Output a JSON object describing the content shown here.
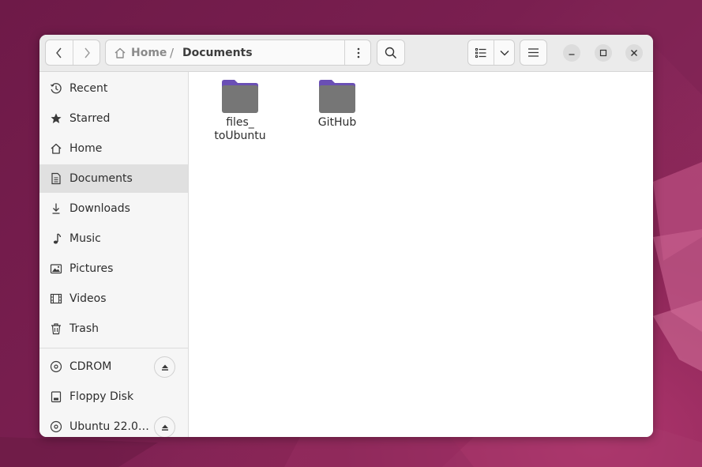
{
  "colors": {
    "wallpaper": "#7a1f50",
    "folder_tab": "#6a4fb5",
    "folder_body": "#767676",
    "sidebar_bg": "#f6f6f6",
    "active_row": "#e0e0e0",
    "headerbar_bg": "#ebebeb"
  },
  "window": {
    "title": "Documents"
  },
  "toolbar": {
    "back_icon": "chevron-left-icon",
    "forward_icon": "chevron-right-icon",
    "search_icon": "search-icon",
    "list_view_icon": "list-view-icon",
    "view_options_icon": "chevron-down-icon",
    "main_menu_icon": "hamburger-icon"
  },
  "breadcrumb": {
    "home_label": "Home",
    "separator": "/",
    "current_label": "Documents",
    "menu_icon": "vertical-dots-icon"
  },
  "window_controls": {
    "minimize_icon": "minimize-icon",
    "maximize_icon": "maximize-icon",
    "close_icon": "close-icon"
  },
  "sidebar": {
    "items": [
      {
        "label": "Recent",
        "icon": "clock-icon"
      },
      {
        "label": "Starred",
        "icon": "star-icon"
      },
      {
        "label": "Home",
        "icon": "home-icon"
      },
      {
        "label": "Documents",
        "icon": "document-icon",
        "active": true
      },
      {
        "label": "Downloads",
        "icon": "download-icon"
      },
      {
        "label": "Music",
        "icon": "music-icon"
      },
      {
        "label": "Pictures",
        "icon": "picture-icon"
      },
      {
        "label": "Videos",
        "icon": "film-icon"
      },
      {
        "label": "Trash",
        "icon": "trash-icon"
      }
    ],
    "devices": [
      {
        "label": "CDROM",
        "icon": "disc-icon",
        "eject": true
      },
      {
        "label": "Floppy Disk",
        "icon": "drive-icon",
        "eject": false
      },
      {
        "label": "Ubuntu 22.0…",
        "icon": "disc-icon",
        "eject": true
      }
    ]
  },
  "content": {
    "files": [
      {
        "name_line1": "files_",
        "name_line2": "toUbuntu",
        "icon": "folder-icon"
      },
      {
        "name_line1": "GitHub",
        "name_line2": "",
        "icon": "folder-icon"
      }
    ]
  }
}
